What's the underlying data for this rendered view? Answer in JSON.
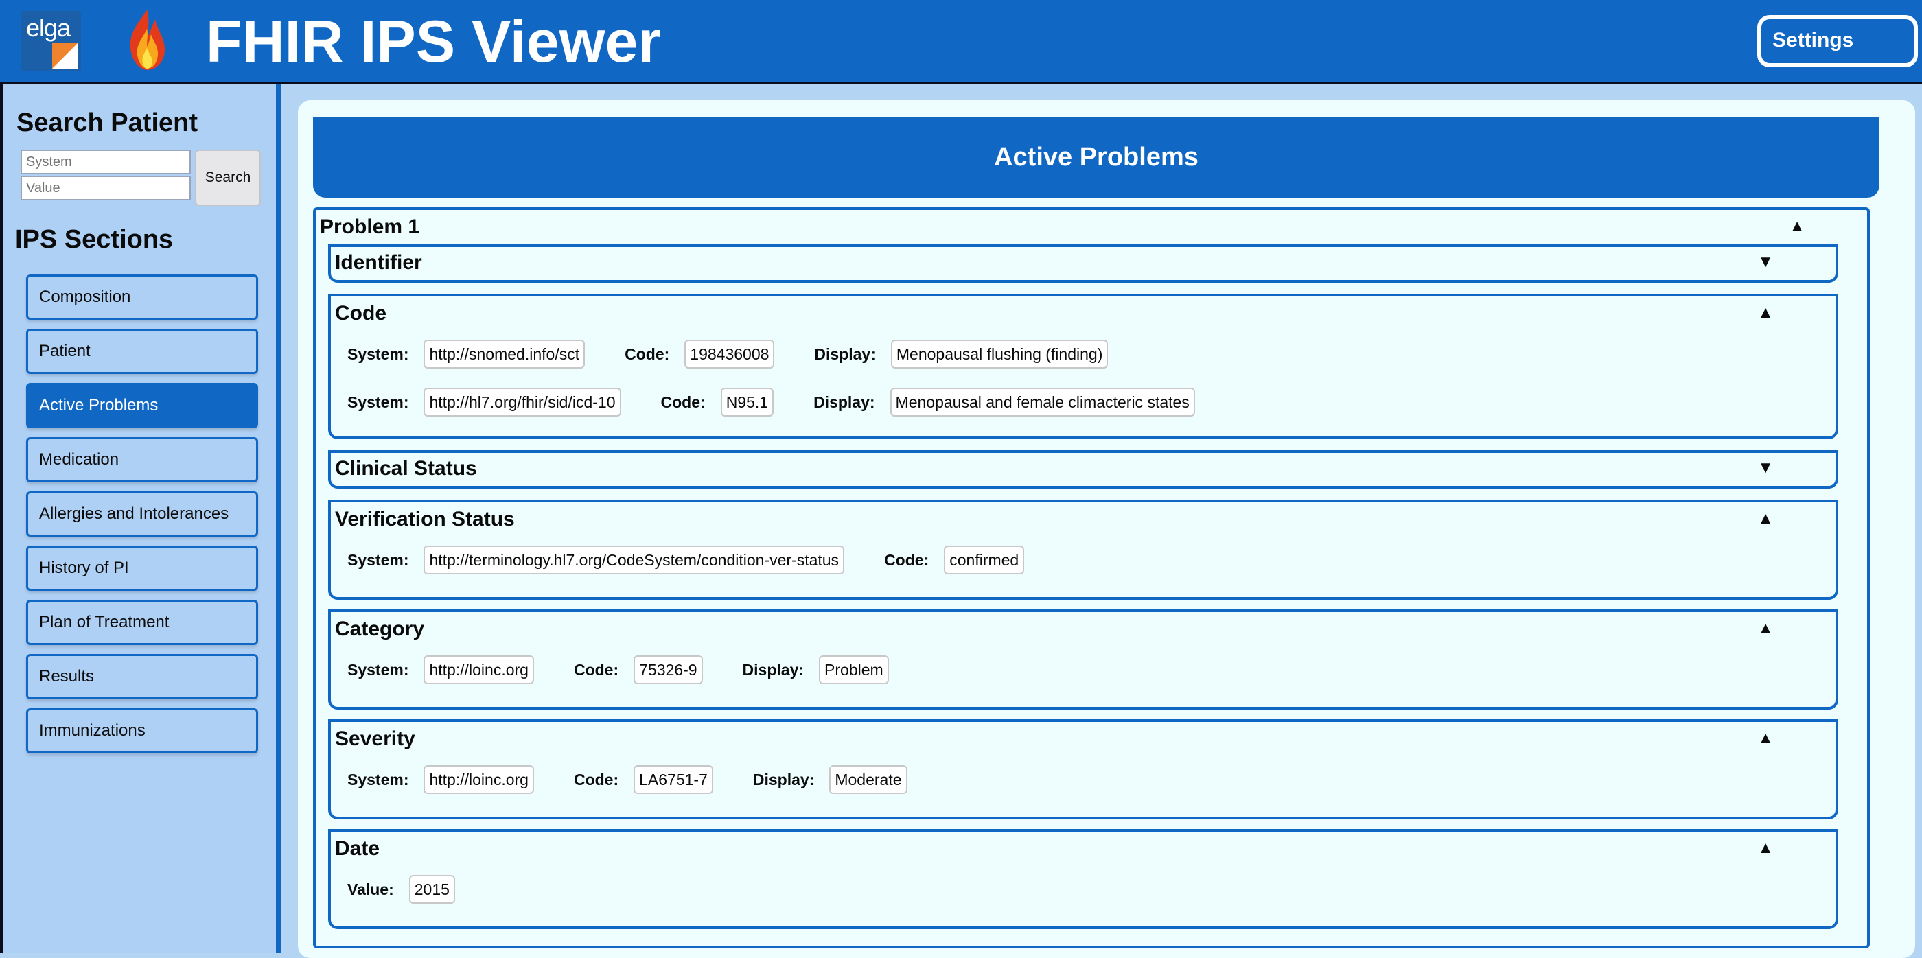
{
  "header": {
    "logo_text": "elga",
    "title": "FHIR IPS Viewer",
    "settings_label": "Settings"
  },
  "sidebar": {
    "search_heading": "Search Patient",
    "system_placeholder": "System",
    "value_placeholder": "Value",
    "search_label": "Search",
    "sections_heading": "IPS Sections",
    "items": [
      {
        "label": "Composition",
        "active": false
      },
      {
        "label": "Patient",
        "active": false
      },
      {
        "label": "Active Problems",
        "active": true
      },
      {
        "label": "Medication",
        "active": false
      },
      {
        "label": "Allergies and Intolerances",
        "active": false
      },
      {
        "label": "History of PI",
        "active": false
      },
      {
        "label": "Plan of Treatment",
        "active": false
      },
      {
        "label": "Results",
        "active": false
      },
      {
        "label": "Immunizations",
        "active": false
      }
    ]
  },
  "main": {
    "section_title": "Active Problems",
    "problem_title": "Problem 1",
    "labels": {
      "system": "System:",
      "code": "Code:",
      "display": "Display:",
      "value": "Value:"
    },
    "carets": {
      "up": "▲",
      "down": "▼"
    },
    "identifier": {
      "title": "Identifier",
      "expanded": false
    },
    "code": {
      "title": "Code",
      "codings": [
        {
          "system": "http://snomed.info/sct",
          "code": "198436008",
          "display": "Menopausal flushing (finding)"
        },
        {
          "system": "http://hl7.org/fhir/sid/icd-10",
          "code": "N95.1",
          "display": "Menopausal and female climacteric states"
        }
      ]
    },
    "clinical_status": {
      "title": "Clinical Status",
      "expanded": false
    },
    "verification_status": {
      "title": "Verification Status",
      "system": "http://terminology.hl7.org/CodeSystem/condition-ver-status",
      "code": "confirmed"
    },
    "category": {
      "title": "Category",
      "system": "http://loinc.org",
      "code": "75326-9",
      "display": "Problem"
    },
    "severity": {
      "title": "Severity",
      "system": "http://loinc.org",
      "code": "LA6751-7",
      "display": "Moderate"
    },
    "date": {
      "title": "Date",
      "value": "2015"
    }
  },
  "colors": {
    "primary": "#1168c4",
    "sidebar_bg": "#afd0f5",
    "panel_bg": "#eefefe",
    "accent_orange": "#f0842c"
  }
}
